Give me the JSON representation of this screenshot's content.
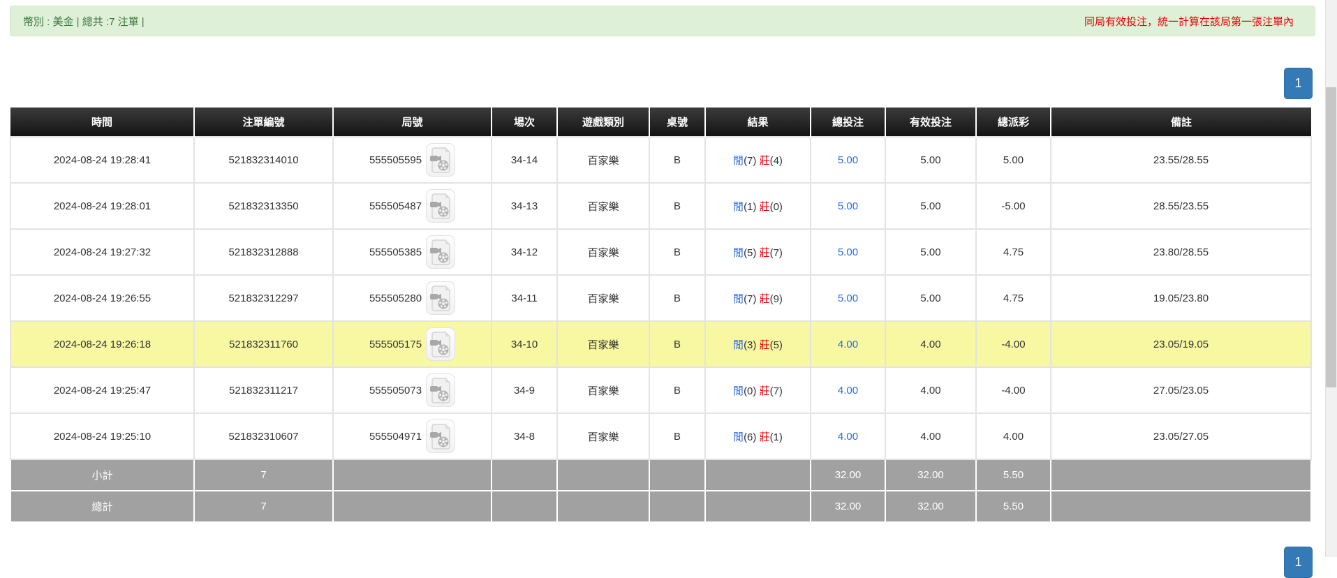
{
  "banner": {
    "left_text": "幣別 : 美金 | 總共 :7 注單 |",
    "right_text": "同局有效投注，統一計算在該局第一張注單內"
  },
  "pagination": {
    "page": "1"
  },
  "icons": {
    "round_video": "video-file-icon"
  },
  "colors": {
    "banner_bg": "#dff0d8",
    "banner_text": "#3c763d",
    "notice_red": "#e60000",
    "header_bg": "#1a1a1a",
    "accent_blue": "#2b6ce6",
    "button_blue": "#337ab7",
    "highlight_yellow": "#f8f8a2",
    "summary_gray": "#a1a1a1"
  },
  "table": {
    "headers": [
      "時間",
      "注單編號",
      "局號",
      "場次",
      "遊戲類別",
      "桌號",
      "結果",
      "總投注",
      "有效投注",
      "總派彩",
      "備註"
    ],
    "rows": [
      {
        "time": "2024-08-24 19:28:41",
        "bet_id": "521832314010",
        "round_no": "555505595",
        "session": "34-14",
        "game": "百家樂",
        "table_no": "B",
        "res_p_label": "閒",
        "res_p_val": "(7)",
        "res_b_label": "莊",
        "res_b_val": "(4)",
        "total_bet": "5.00",
        "valid_bet": "5.00",
        "payout": "5.00",
        "remark": "23.55/28.55",
        "highlight": false
      },
      {
        "time": "2024-08-24 19:28:01",
        "bet_id": "521832313350",
        "round_no": "555505487",
        "session": "34-13",
        "game": "百家樂",
        "table_no": "B",
        "res_p_label": "閒",
        "res_p_val": "(1)",
        "res_b_label": "莊",
        "res_b_val": "(0)",
        "total_bet": "5.00",
        "valid_bet": "5.00",
        "payout": "-5.00",
        "remark": "28.55/23.55",
        "highlight": false
      },
      {
        "time": "2024-08-24 19:27:32",
        "bet_id": "521832312888",
        "round_no": "555505385",
        "session": "34-12",
        "game": "百家樂",
        "table_no": "B",
        "res_p_label": "閒",
        "res_p_val": "(5)",
        "res_b_label": "莊",
        "res_b_val": "(7)",
        "total_bet": "5.00",
        "valid_bet": "5.00",
        "payout": "4.75",
        "remark": "23.80/28.55",
        "highlight": false
      },
      {
        "time": "2024-08-24 19:26:55",
        "bet_id": "521832312297",
        "round_no": "555505280",
        "session": "34-11",
        "game": "百家樂",
        "table_no": "B",
        "res_p_label": "閒",
        "res_p_val": "(7)",
        "res_b_label": "莊",
        "res_b_val": "(9)",
        "total_bet": "5.00",
        "valid_bet": "5.00",
        "payout": "4.75",
        "remark": "19.05/23.80",
        "highlight": false
      },
      {
        "time": "2024-08-24 19:26:18",
        "bet_id": "521832311760",
        "round_no": "555505175",
        "session": "34-10",
        "game": "百家樂",
        "table_no": "B",
        "res_p_label": "閒",
        "res_p_val": "(3)",
        "res_b_label": "莊",
        "res_b_val": "(5)",
        "total_bet": "4.00",
        "valid_bet": "4.00",
        "payout": "-4.00",
        "remark": "23.05/19.05",
        "highlight": true
      },
      {
        "time": "2024-08-24 19:25:47",
        "bet_id": "521832311217",
        "round_no": "555505073",
        "session": "34-9",
        "game": "百家樂",
        "table_no": "B",
        "res_p_label": "閒",
        "res_p_val": "(0)",
        "res_b_label": "莊",
        "res_b_val": "(7)",
        "total_bet": "4.00",
        "valid_bet": "4.00",
        "payout": "-4.00",
        "remark": "27.05/23.05",
        "highlight": false
      },
      {
        "time": "2024-08-24 19:25:10",
        "bet_id": "521832310607",
        "round_no": "555504971",
        "session": "34-8",
        "game": "百家樂",
        "table_no": "B",
        "res_p_label": "閒",
        "res_p_val": "(6)",
        "res_b_label": "莊",
        "res_b_val": "(1)",
        "total_bet": "4.00",
        "valid_bet": "4.00",
        "payout": "4.00",
        "remark": "23.05/27.05",
        "highlight": false
      }
    ],
    "subtotal": {
      "label": "小計",
      "count": "7",
      "total_bet": "32.00",
      "valid_bet": "32.00",
      "payout": "5.50"
    },
    "total": {
      "label": "總計",
      "count": "7",
      "total_bet": "32.00",
      "valid_bet": "32.00",
      "payout": "5.50"
    }
  }
}
